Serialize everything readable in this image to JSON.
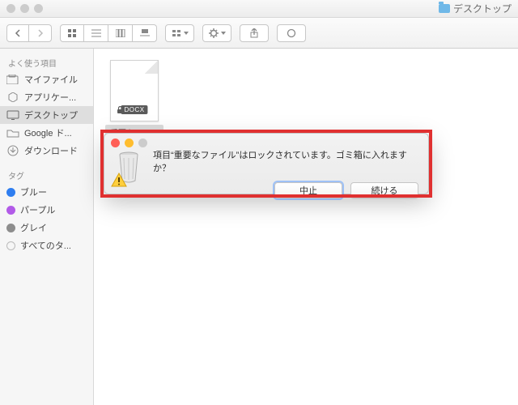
{
  "window": {
    "title": "デスクトップ"
  },
  "sidebar": {
    "favorites_label": "よく使う項目",
    "tags_label": "タグ",
    "items": [
      {
        "label": "マイファイル",
        "icon": "my-files"
      },
      {
        "label": "アプリケー...",
        "icon": "applications"
      },
      {
        "label": "デスクトップ",
        "icon": "desktop",
        "selected": true
      },
      {
        "label": "Google ド...",
        "icon": "folder"
      },
      {
        "label": "ダウンロード",
        "icon": "downloads"
      }
    ],
    "tags": [
      {
        "label": "ブルー",
        "color": "#2f7ef0"
      },
      {
        "label": "パープル",
        "color": "#b25be8"
      },
      {
        "label": "グレイ",
        "color": "#8d8d8d"
      },
      {
        "label": "すべてのタ...",
        "color": ""
      }
    ]
  },
  "file": {
    "badge": "DOCX",
    "name": "重要なファイル"
  },
  "dialog": {
    "message": "項目“重要なファイル”はロックされています。ゴミ箱に入れますか？",
    "cancel": "中止",
    "continue": "続ける"
  }
}
